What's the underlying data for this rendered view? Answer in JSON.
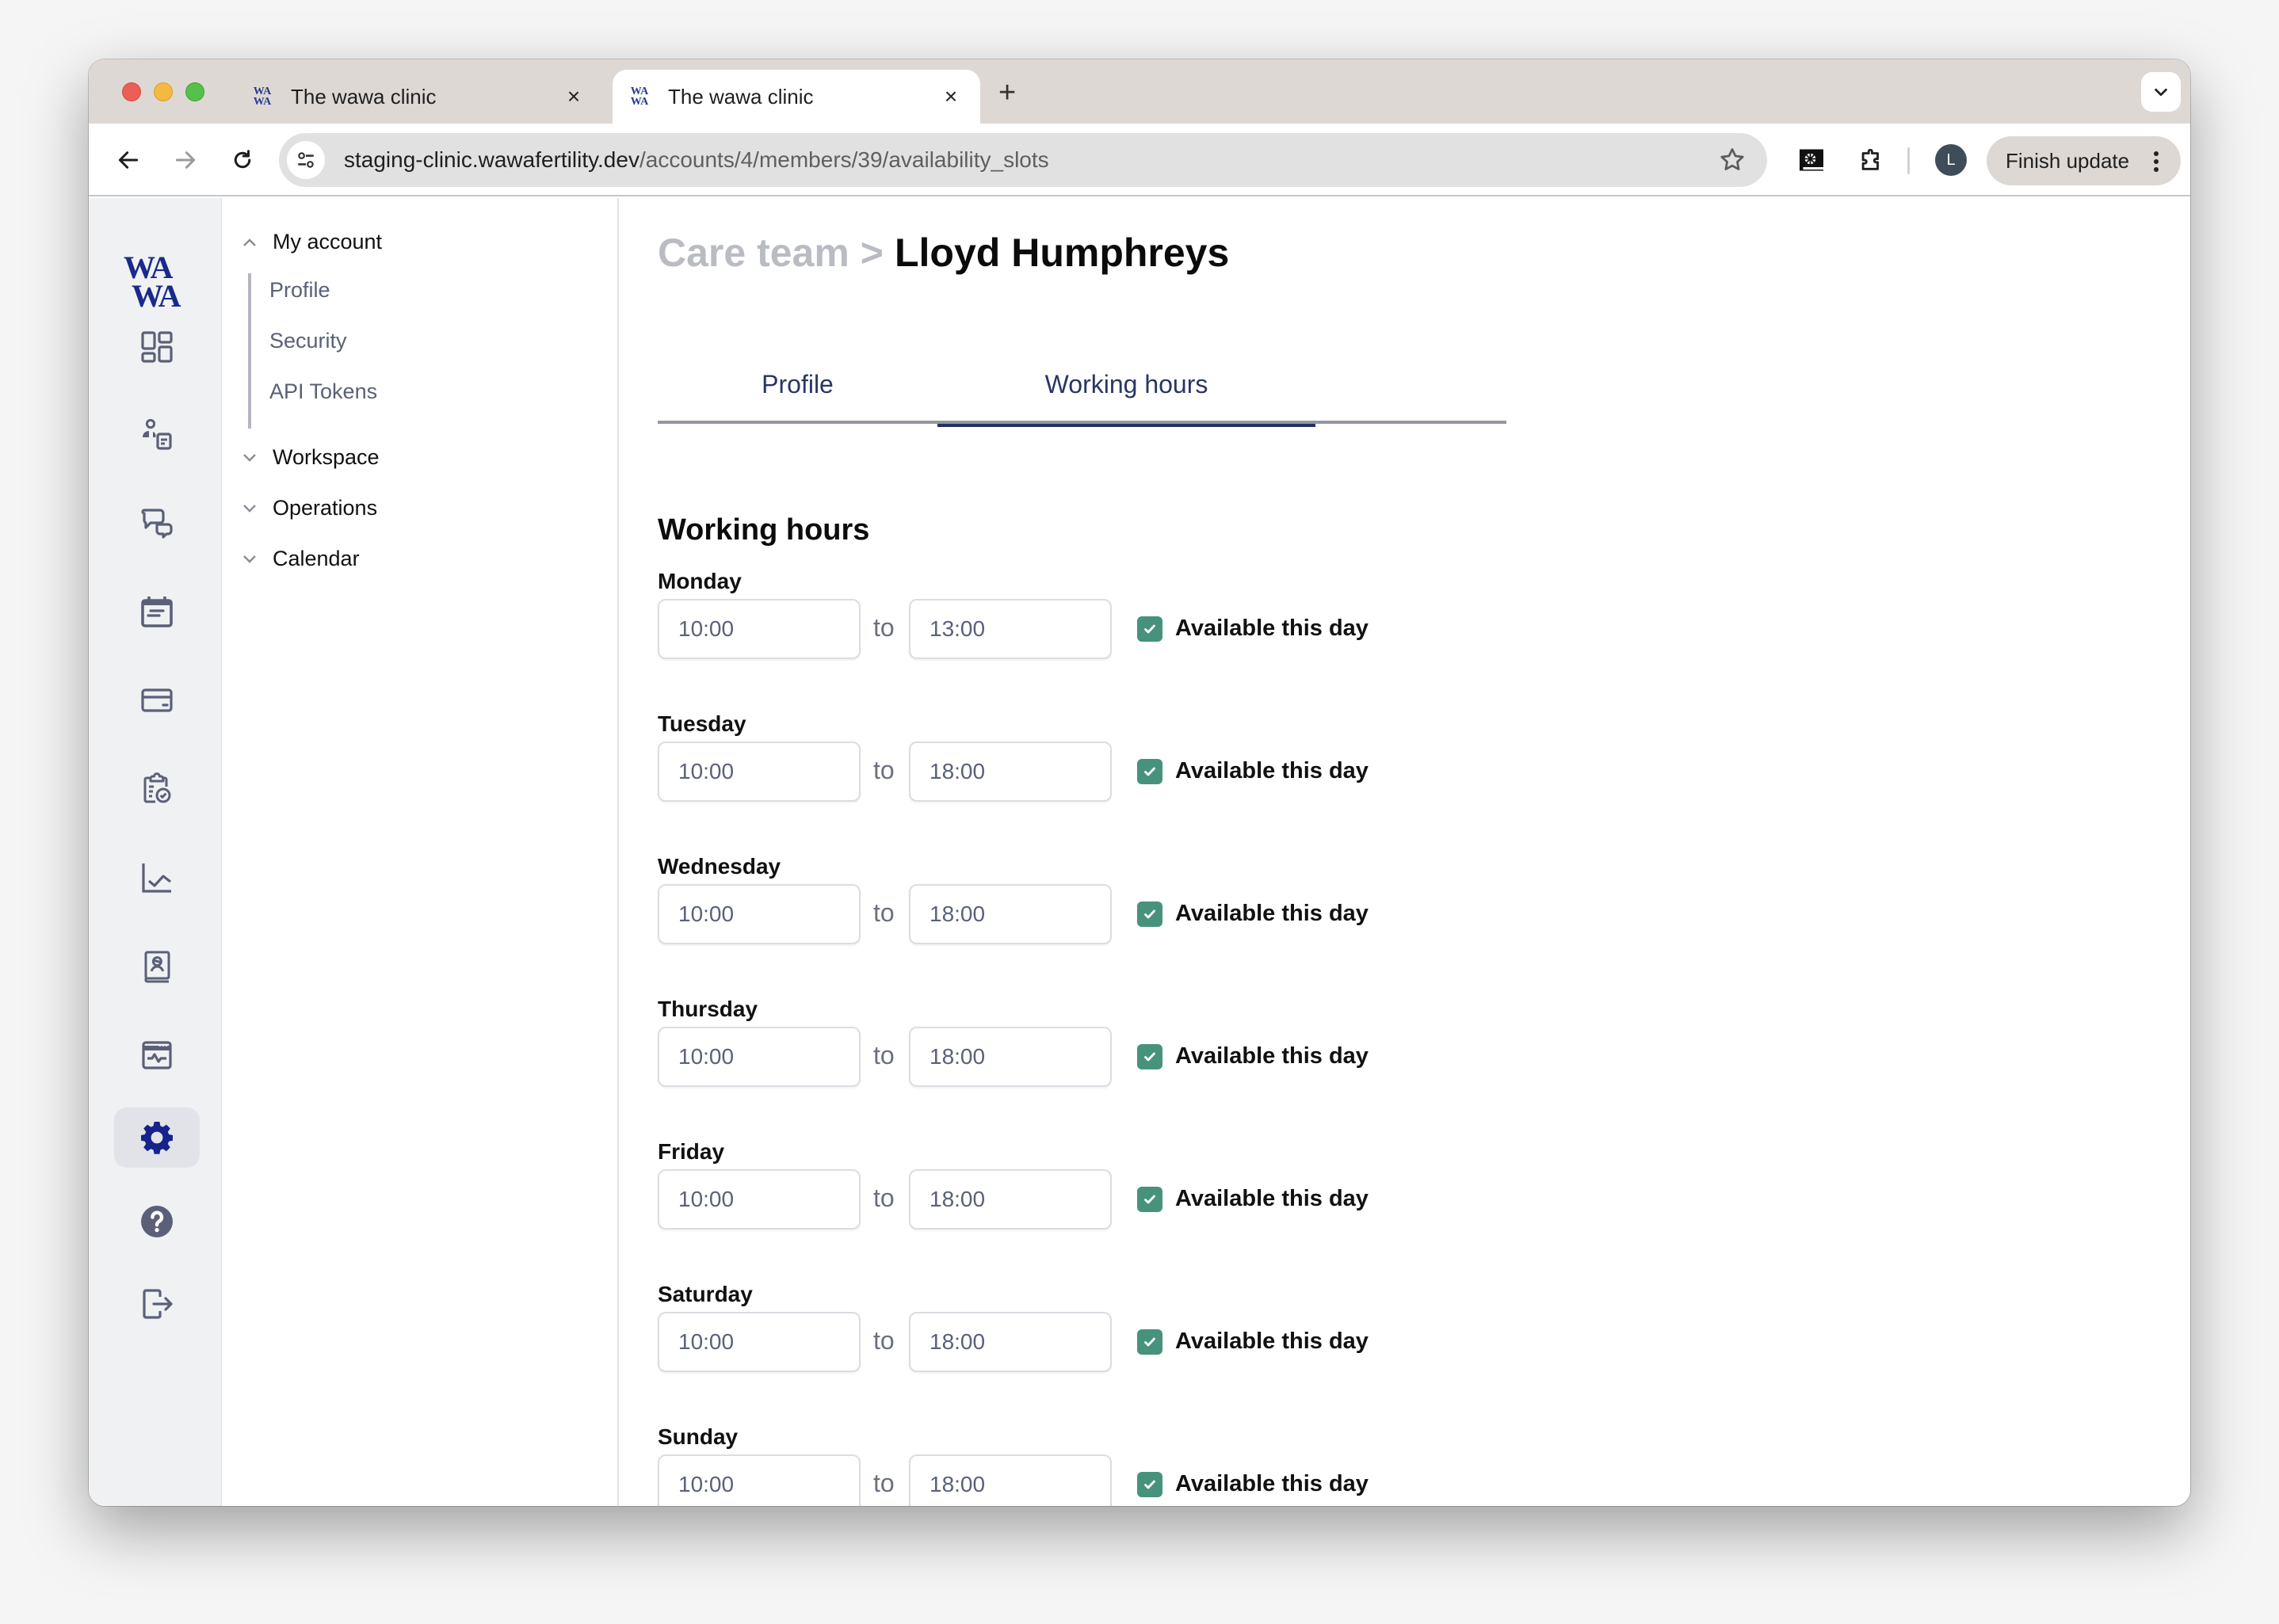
{
  "browser": {
    "tabs": [
      {
        "title": "The wawa clinic",
        "favicon": "WA WA",
        "active": false
      },
      {
        "title": "The wawa clinic",
        "favicon": "WA WA",
        "active": true
      }
    ],
    "new_tab_icon": "+",
    "tab_search_icon": "chevron-down-icon",
    "url_host": "staging-clinic.wawafertility.dev",
    "url_path": "/accounts/4/members/39/availability_slots",
    "avatar_initial": "L",
    "finish_update_label": "Finish update"
  },
  "rail": {
    "logo_line1": "WA",
    "logo_line2": "WA",
    "items": [
      {
        "icon": "dashboard-icon"
      },
      {
        "icon": "patients-icon"
      },
      {
        "icon": "chat-icon"
      },
      {
        "icon": "calendar-icon"
      },
      {
        "icon": "billing-card-icon"
      },
      {
        "icon": "clipboard-check-icon"
      },
      {
        "icon": "analytics-chart-icon"
      },
      {
        "icon": "contacts-book-icon"
      },
      {
        "icon": "monitoring-icon"
      },
      {
        "icon": "settings-gear-icon",
        "active": true
      },
      {
        "icon": "help-icon"
      },
      {
        "icon": "logout-icon"
      }
    ]
  },
  "subnav": {
    "groups": [
      {
        "label": "My account",
        "expanded": true,
        "items": [
          "Profile",
          "Security",
          "API Tokens"
        ]
      },
      {
        "label": "Workspace",
        "expanded": false
      },
      {
        "label": "Operations",
        "expanded": false
      },
      {
        "label": "Calendar",
        "expanded": false
      }
    ]
  },
  "main": {
    "breadcrumb_parent": "Care team",
    "breadcrumb_separator": ">",
    "breadcrumb_current": "Lloyd Humphreys",
    "tabs": [
      {
        "label": "Profile",
        "active": false
      },
      {
        "label": "Working hours",
        "active": true
      }
    ],
    "section_title": "Working hours",
    "to_label": "to",
    "available_label": "Available this day",
    "accent_color": "#47927c",
    "days": [
      {
        "name": "Monday",
        "from": "10:00",
        "to": "13:00",
        "available": true
      },
      {
        "name": "Tuesday",
        "from": "10:00",
        "to": "18:00",
        "available": true
      },
      {
        "name": "Wednesday",
        "from": "10:00",
        "to": "18:00",
        "available": true
      },
      {
        "name": "Thursday",
        "from": "10:00",
        "to": "18:00",
        "available": true
      },
      {
        "name": "Friday",
        "from": "10:00",
        "to": "18:00",
        "available": true
      },
      {
        "name": "Saturday",
        "from": "10:00",
        "to": "18:00",
        "available": true
      },
      {
        "name": "Sunday",
        "from": "10:00",
        "to": "18:00",
        "available": true
      }
    ]
  }
}
